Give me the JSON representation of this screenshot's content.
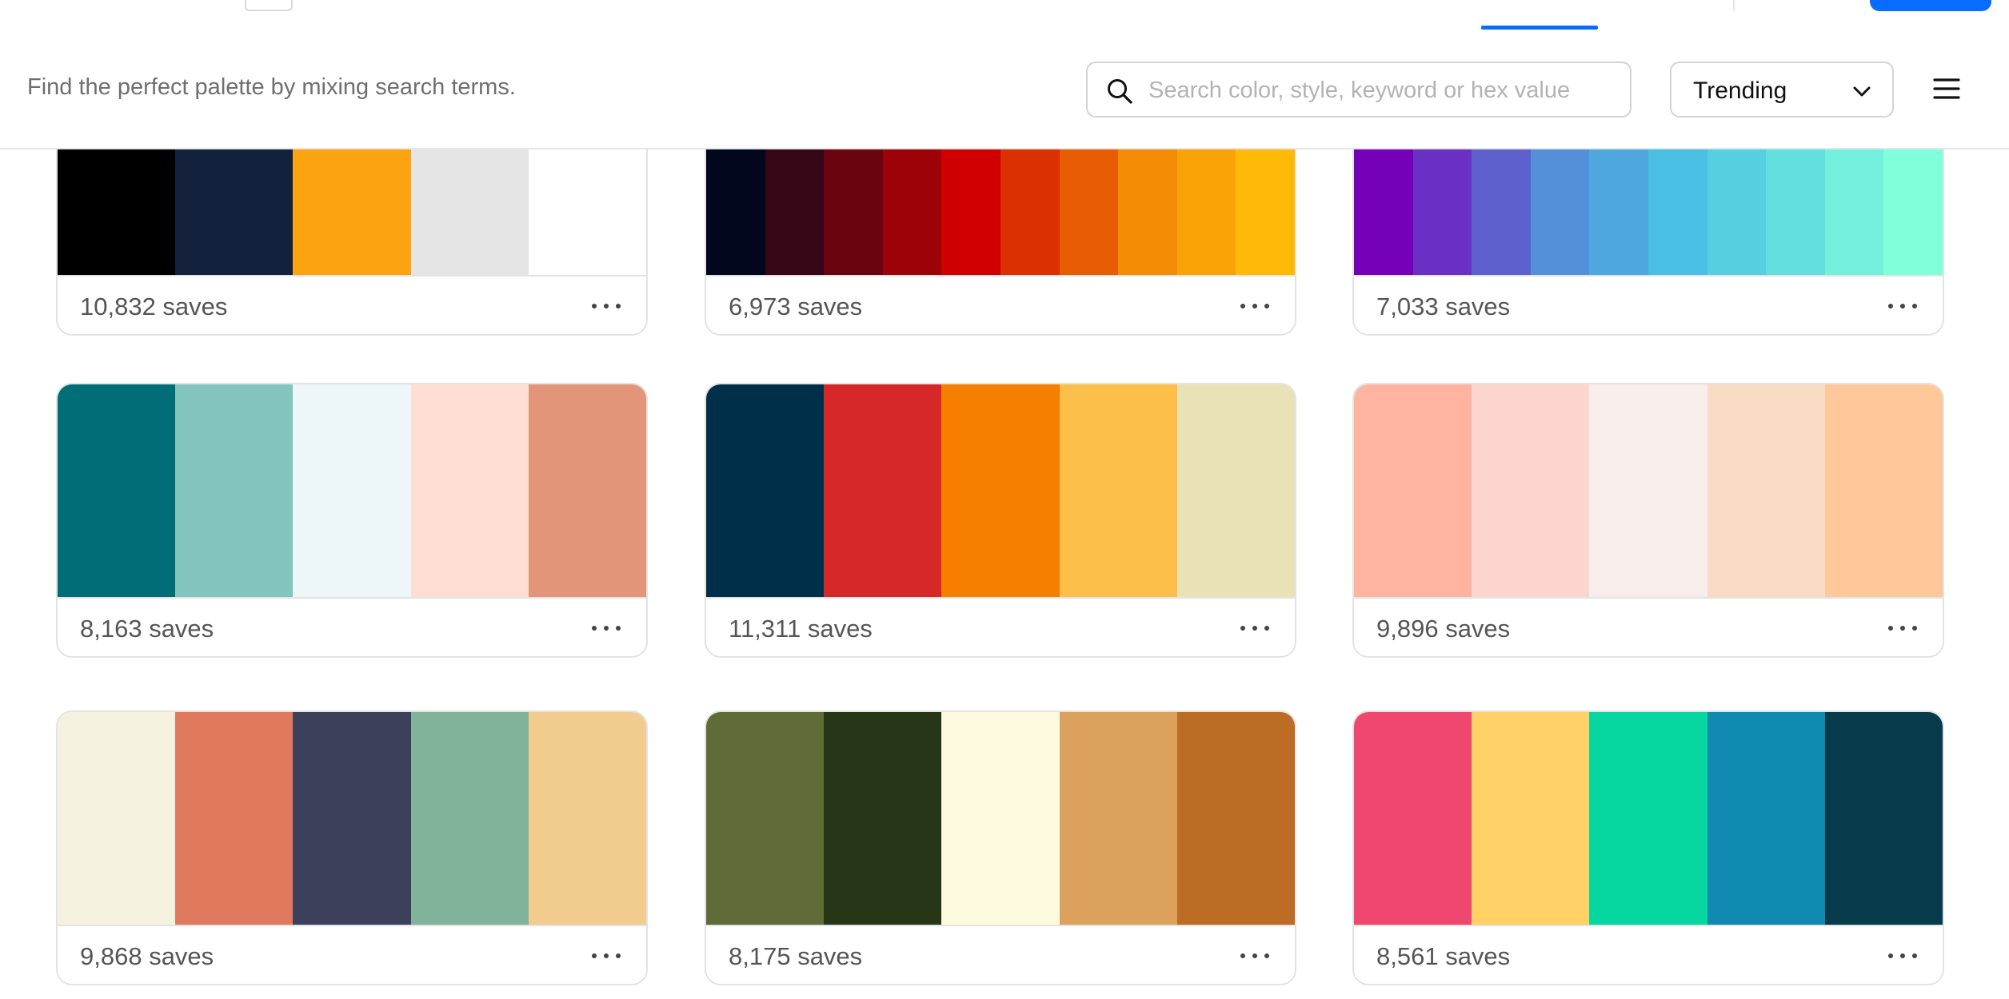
{
  "filter_bar": {
    "tagline": "Find the perfect palette by mixing search terms.",
    "search_placeholder": "Search color, style, keyword or hex value",
    "sort_selected": "Trending"
  },
  "colors": {
    "accent": "#0a6cff"
  },
  "palettes": [
    {
      "saves": "10,832 saves",
      "colors": [
        "#000000",
        "#14213d",
        "#fca311",
        "#e5e5e5",
        "#ffffff"
      ]
    },
    {
      "saves": "6,973 saves",
      "colors": [
        "#03071e",
        "#370617",
        "#6a040f",
        "#9d0208",
        "#d00000",
        "#dc2f02",
        "#e85d04",
        "#f48c06",
        "#faa307",
        "#ffba08"
      ]
    },
    {
      "saves": "7,033 saves",
      "colors": [
        "#7400b8",
        "#6930c3",
        "#5e60ce",
        "#5390d9",
        "#4ea8de",
        "#48bfe3",
        "#56cfe1",
        "#64dfdf",
        "#72efdd",
        "#80ffdb"
      ]
    },
    {
      "saves": "8,163 saves",
      "colors": [
        "#006d77",
        "#83c5be",
        "#edf6f9",
        "#ffddd2",
        "#e29578"
      ]
    },
    {
      "saves": "11,311 saves",
      "colors": [
        "#003049",
        "#d62828",
        "#f77f00",
        "#fcbf49",
        "#eae2b7"
      ]
    },
    {
      "saves": "9,896 saves",
      "colors": [
        "#ffb4a2",
        "#fcd5ce",
        "#f8edeb",
        "#f9dcc4",
        "#fec89a"
      ]
    },
    {
      "saves": "9,868 saves",
      "colors": [
        "#f4f1de",
        "#e07a5f",
        "#3d405b",
        "#81b29a",
        "#f2cc8f"
      ]
    },
    {
      "saves": "8,175 saves",
      "colors": [
        "#606c38",
        "#283618",
        "#fefae0",
        "#dda15e",
        "#bc6c25"
      ]
    },
    {
      "saves": "8,561 saves",
      "colors": [
        "#ef476f",
        "#ffd166",
        "#06d6a0",
        "#118ab2",
        "#073b4c"
      ]
    }
  ]
}
